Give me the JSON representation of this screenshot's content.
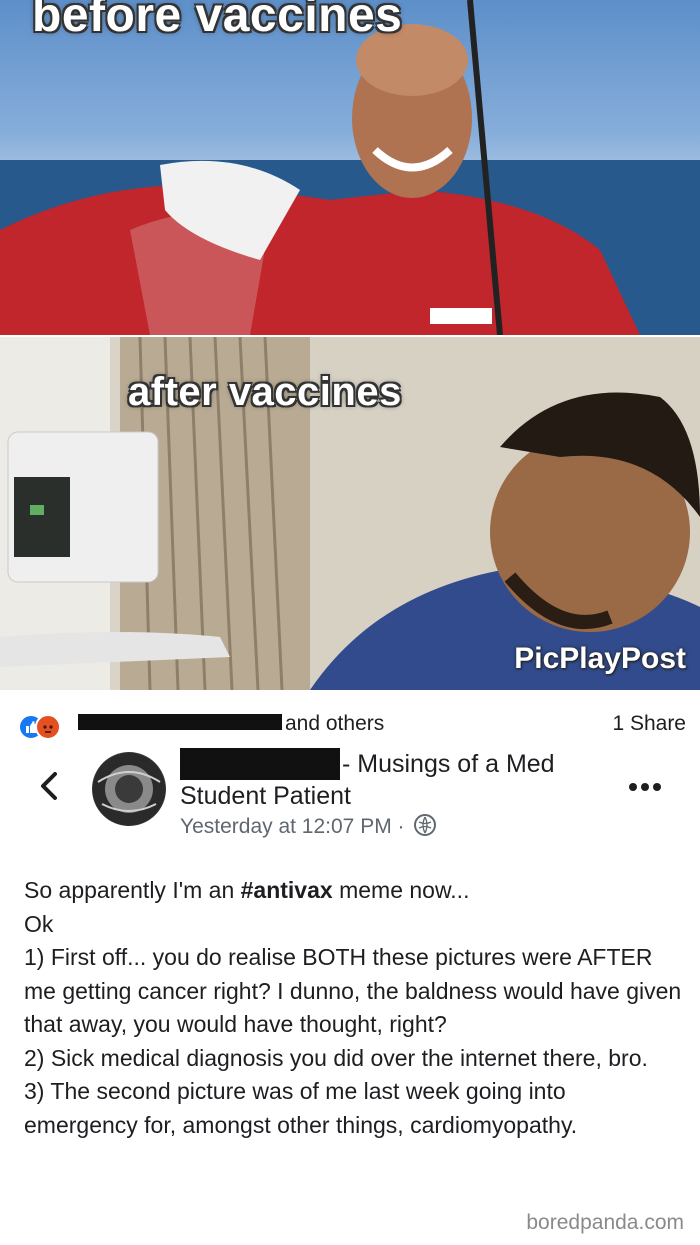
{
  "meme": {
    "top_caption": "before vaccines",
    "bottom_caption": "after vaccines",
    "watermark": "PicPlayPost"
  },
  "reactions": {
    "others_label": "and others",
    "share_count": "1 Share"
  },
  "post": {
    "author_suffix": "- Musings of a Med",
    "author_line2": "Student Patient",
    "timestamp": "Yesterday at 12:07 PM ·",
    "lines": [
      "So apparently I'm an #antivax meme now...",
      "Ok",
      "1) First off... you do realise BOTH these pictures were AFTER me getting cancer right? I dunno, the baldness would have given that away, you would have thought, right?",
      "2) Sick medical diagnosis you did over the internet there, bro.",
      "3) The second picture was of me last week going into emergency for, amongst other things, cardiomyopathy."
    ],
    "hashtag": "#antivax"
  },
  "credit": "boredpanda.com",
  "colors": {
    "accent": "#1877f2",
    "text": "#1c1e21",
    "muted": "#606770"
  }
}
